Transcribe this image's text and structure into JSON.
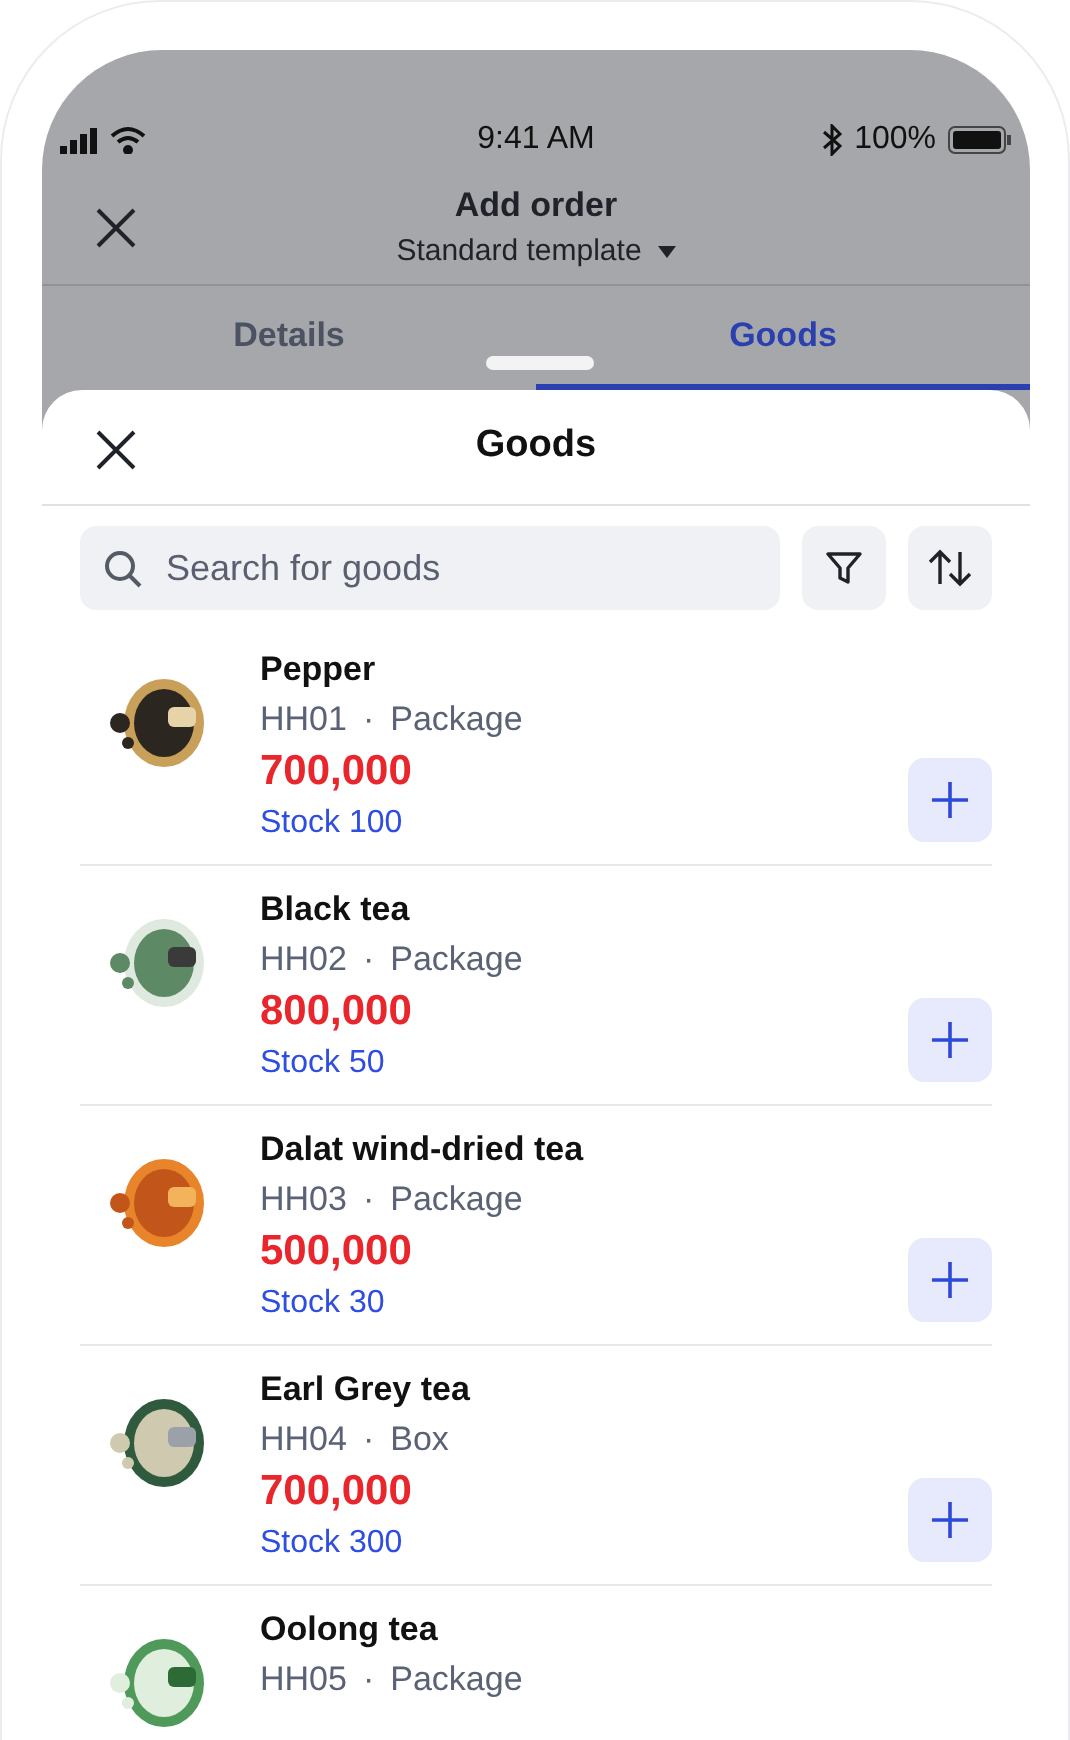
{
  "status_bar": {
    "time": "9:41 AM",
    "battery": "100%"
  },
  "header": {
    "title": "Add order",
    "subtitle": "Standard template"
  },
  "tabs": [
    {
      "label": "Details",
      "selected": false
    },
    {
      "label": "Goods",
      "selected": true
    }
  ],
  "sheet": {
    "title": "Goods",
    "search": {
      "placeholder": "Search for goods"
    }
  },
  "products": [
    {
      "name": "Pepper",
      "code": "HH01",
      "separator": "·",
      "unit": "Package",
      "price": "700,000",
      "stock": "Stock 100",
      "kind": "picture"
    },
    {
      "name": "Black tea",
      "code": "HH02",
      "separator": "·",
      "unit": "Package",
      "price": "800,000",
      "stock": "Stock 50",
      "kind": "picture"
    },
    {
      "name": "Dalat wind-dried tea",
      "code": "HH03",
      "separator": "·",
      "unit": "Package",
      "price": "500,000",
      "stock": "Stock 30",
      "kind": "picture"
    },
    {
      "name": "Earl Grey tea",
      "code": "HH04",
      "separator": "·",
      "unit": "Box",
      "price": "700,000",
      "stock": "Stock 300",
      "kind": "picture"
    },
    {
      "name": "Oolong tea",
      "code": "HH05",
      "separator": "·",
      "unit": "Package",
      "kind": "picture"
    }
  ]
}
